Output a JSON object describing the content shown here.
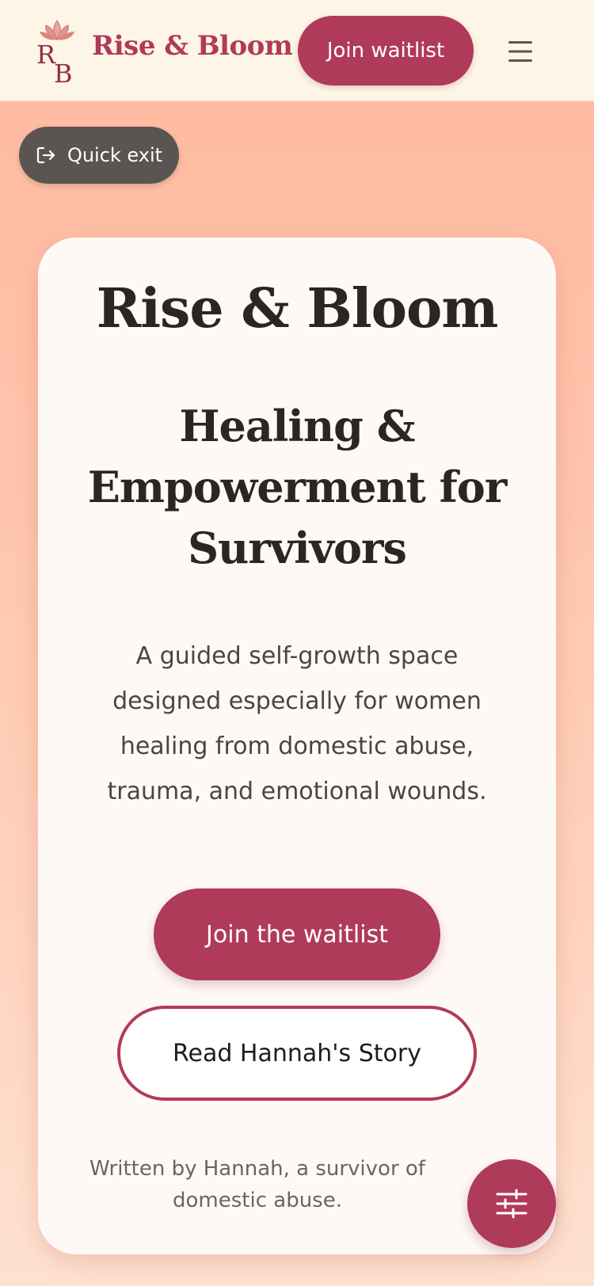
{
  "header": {
    "logo_icon": "lotus-monogram-icon",
    "brand_name": "Rise & Bloom",
    "join_waitlist_label": "Join waitlist",
    "menu_icon": "hamburger-menu-icon"
  },
  "quick_exit": {
    "label": "Quick exit",
    "icon": "exit-arrow-icon"
  },
  "hero": {
    "title": "Rise & Bloom",
    "subtitle": "Healing & Empowerment for Survivors",
    "description": "A guided self-growth space designed especially for women healing from domestic abuse, trauma, and emotional wounds.",
    "primary_cta": "Join the waitlist",
    "secondary_cta": "Read Hannah's Story",
    "author_note": "Written by Hannah, a survivor of domestic abuse."
  },
  "fab": {
    "icon": "sliders-icon"
  },
  "colors": {
    "brand": "#b03a5a",
    "header_bg": "#fdf5e6",
    "quick_exit_bg": "#5a5552",
    "page_bg_top": "#ffb9a0",
    "card_bg": "#fff9f6",
    "heading_text": "#2a2622"
  }
}
